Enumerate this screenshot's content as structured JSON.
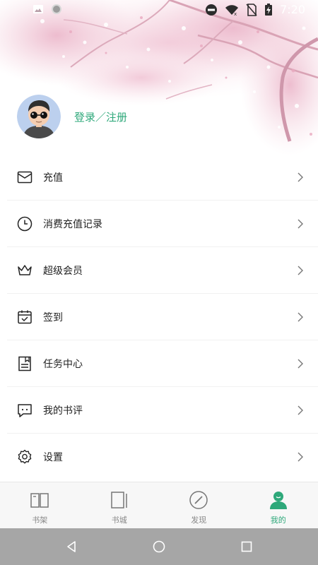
{
  "status_bar": {
    "time": "7:20",
    "icons": [
      "image-icon",
      "circle-icon",
      "do-not-disturb-icon",
      "wifi-icon",
      "no-sim-icon",
      "battery-charging-icon"
    ]
  },
  "profile": {
    "login_label": "登录／注册",
    "avatar": "avatar-glasses-man"
  },
  "menu": {
    "items": [
      {
        "label": "充值",
        "icon": "wallet-icon"
      },
      {
        "label": "消费充值记录",
        "icon": "clock-icon"
      },
      {
        "label": "超级会员",
        "icon": "crown-icon"
      },
      {
        "label": "签到",
        "icon": "calendar-check-icon"
      },
      {
        "label": "任务中心",
        "icon": "task-document-icon"
      },
      {
        "label": "我的书评",
        "icon": "comment-icon"
      },
      {
        "label": "设置",
        "icon": "gear-icon"
      }
    ]
  },
  "bottom_nav": {
    "items": [
      {
        "label": "书架",
        "icon": "open-book-icon",
        "active": false
      },
      {
        "label": "书城",
        "icon": "book-store-icon",
        "active": false
      },
      {
        "label": "发现",
        "icon": "compass-icon",
        "active": false
      },
      {
        "label": "我的",
        "icon": "profile-icon",
        "active": true
      }
    ]
  },
  "system_nav": {
    "buttons": [
      "back-icon",
      "home-icon",
      "recents-icon"
    ]
  },
  "colors": {
    "accent": "#2ea87a",
    "text": "#222222",
    "nav_inactive": "#888888",
    "blossom": "#f2c9d8",
    "system_bar": "#a6a6a6"
  }
}
